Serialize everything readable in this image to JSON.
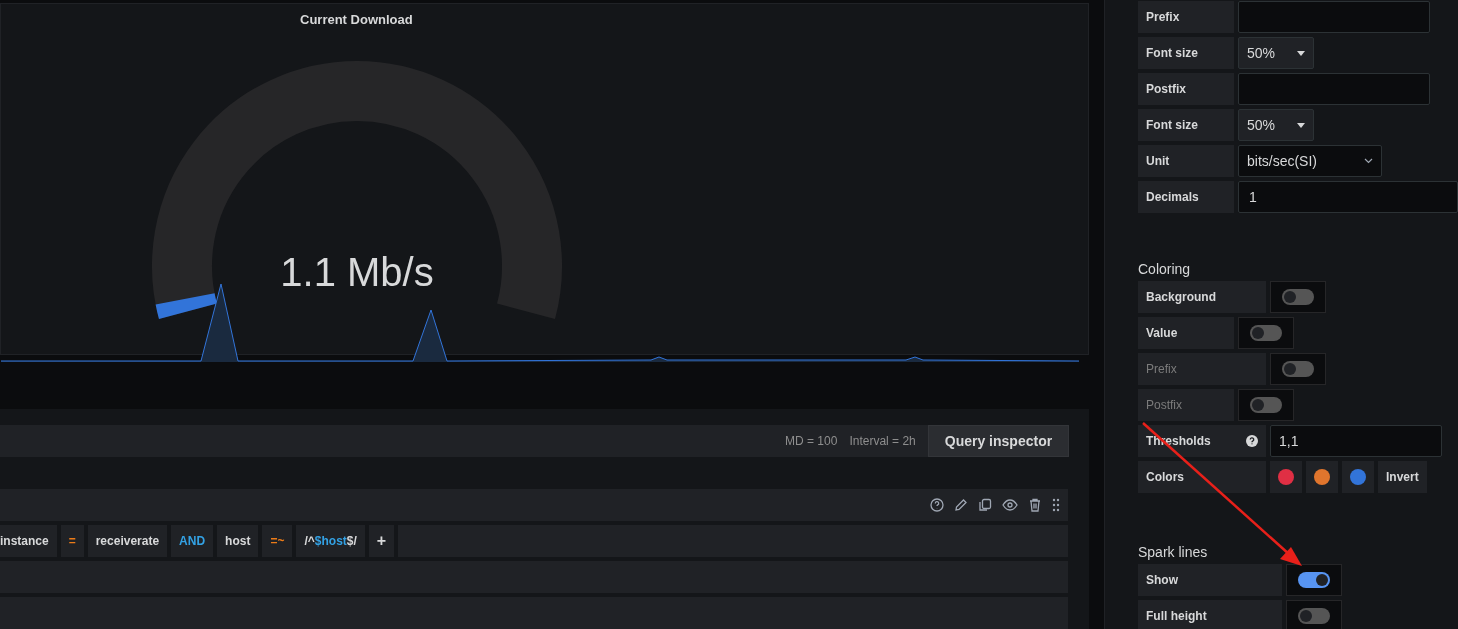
{
  "panel": {
    "title": "Current Download",
    "value": "1.1 Mb/s",
    "gauge": {
      "level": 0.02
    }
  },
  "query": {
    "max_data_points": "MD = 100",
    "interval": "Interval = 2h",
    "inspector_button": "Query inspector",
    "segments": [
      {
        "kind": "field",
        "text": "instance"
      },
      {
        "kind": "operator",
        "text": "="
      },
      {
        "kind": "field",
        "text": "receiverate"
      },
      {
        "kind": "keyword",
        "text": "AND"
      },
      {
        "kind": "field",
        "text": "host"
      },
      {
        "kind": "operator",
        "text": "=~"
      },
      {
        "kind": "regex",
        "prefix": "/^",
        "variable": "$host",
        "suffix": "$/"
      },
      {
        "kind": "add",
        "text": "+"
      }
    ]
  },
  "value_options": [
    {
      "label": "Prefix",
      "kind": "input"
    },
    {
      "label": "Font size",
      "kind": "select",
      "value": "50%"
    },
    {
      "label": "Postfix",
      "kind": "input"
    },
    {
      "label": "Font size",
      "kind": "select",
      "value": "50%"
    },
    {
      "label": "Unit",
      "kind": "picker",
      "value": "bits/sec(SI)"
    },
    {
      "label": "Decimals",
      "kind": "input",
      "value": "1"
    }
  ],
  "coloring": {
    "title": "Coloring",
    "rows": [
      {
        "label": "Background",
        "kind": "switch",
        "on": false,
        "disabled": false
      },
      {
        "label": "Value",
        "kind": "switch",
        "on": false,
        "disabled": false
      },
      {
        "label": "Prefix",
        "kind": "switch",
        "on": false,
        "disabled": true
      },
      {
        "label": "Postfix",
        "kind": "switch",
        "on": false,
        "disabled": true
      },
      {
        "label": "Thresholds",
        "kind": "thresholds",
        "value": "1,1",
        "disabled": false
      },
      {
        "label": "Colors",
        "kind": "colors",
        "colors": [
          {
            "color": "#e02f44"
          },
          {
            "color": "#e0752d"
          },
          {
            "color": "#3274d9"
          }
        ],
        "button": "Invert",
        "disabled": false
      }
    ]
  },
  "spark_lines": {
    "title": "Spark lines",
    "rows": [
      {
        "label": "Show",
        "kind": "switch",
        "on": true
      },
      {
        "label": "Full height",
        "kind": "switch",
        "on": false
      }
    ]
  }
}
